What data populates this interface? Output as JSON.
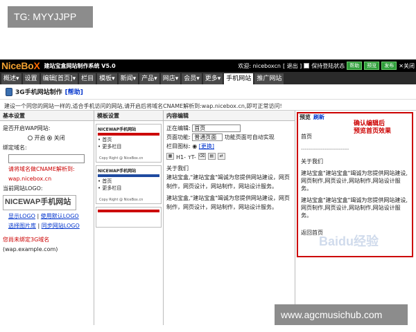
{
  "watermarks": {
    "top": "TG: MYYJJPP",
    "bottom": "www.agcmusichub.com",
    "baidu": "Baidu经验"
  },
  "app": {
    "logo": "NiceBo",
    "logo_x": "X",
    "system_title": "建站宝盒网站制作系统 V5.0",
    "welcome": "欢迎: niceboxcn",
    "logout": "[ 退出 ]",
    "keep_login": "保持登陆状态",
    "buttons": {
      "help": "帮助",
      "preview": "预览",
      "publish": "发布"
    },
    "close": "关闭"
  },
  "nav": [
    "概述▾",
    "设置",
    "编辑[首页]▾",
    "栏目",
    "模板▾",
    "新闻▾",
    "产品▾",
    "网店▾",
    "会员▾",
    "更多▾",
    "手机网站",
    "推广网站"
  ],
  "page": {
    "title": "3G手机网站制作",
    "help": "[帮助]",
    "description": "建设一个同您的网站一样的,适合手机访问的网站,请开启后将域名CNAME解析到:wap.nicebox.cn,即可正常访问!"
  },
  "basic": {
    "header": "基本设置",
    "wap_question": "是否开启WAP网站:",
    "on": "开启",
    "off": "关闭",
    "bind_domain": "绑定域名:",
    "cname_hint": "请将域名做CNAME解析到:",
    "cname_target": "wap.nicebox.cn",
    "logo_label": "当前网站LOGO:",
    "logo_text": "NICEWAP手机网站",
    "links": [
      "显示LOGO",
      "使用默认LOGO",
      "选择图片库",
      "同步网站LOGO"
    ],
    "unbound": "您尚未绑定3G域名",
    "example": "(wap.example.com)"
  },
  "templates": {
    "header": "模板设置",
    "items": [
      {
        "brand": "NICEWAP手机网站",
        "links": [
          "首页",
          "更多栏目"
        ],
        "footer": "Copy Right @ NiceBox.cn"
      },
      {
        "brand": "NICEWAP手机网站",
        "links": [
          "首页",
          "更多栏目"
        ],
        "footer": "Copy Right @ NiceBox.cn"
      }
    ]
  },
  "editor": {
    "header": "内容编辑",
    "editing_label": "正在编辑:",
    "editing_value": "首页",
    "function_label": "页面功能:",
    "function_value": "普通页面",
    "function_note": "功能页面可自动实现",
    "icon_label": "栏目图标:",
    "change": "[更换]",
    "toolbar": [
      "▦",
      "H1-",
      "тT-",
      "⌫",
      "▤",
      "⇄"
    ],
    "about": "关于我们",
    "paragraph": "建站宝盒,\"建站宝盒\"竭诚为您提供网站建设，网页制作，网页设计，网站制作，网站设计服务。"
  },
  "preview": {
    "header": "预览",
    "refresh": "刷新",
    "callout_line1": "确认编辑后",
    "callout_line2": "预览首页效果",
    "home": "首页",
    "divider": "------------------------",
    "about": "关于我们",
    "text1": "建站宝盒\"建站宝盒\"竭诚为您提供网站建设,网页制作,网页设计,网站制作,网站设计服务。",
    "text2": "建站宝盒\"建站宝盒\"竭诚为您提供网站建设,网页制作,网页设计,网站制作,网站设计服务。",
    "back": "返回首页"
  }
}
